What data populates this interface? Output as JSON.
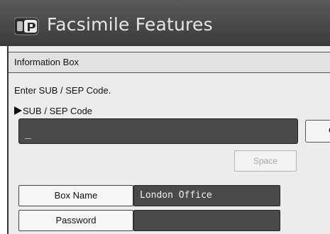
{
  "window": {
    "title": "Facsimile Features",
    "icon": "fax-machine-icon"
  },
  "section": {
    "title": "Information Box"
  },
  "instruction": "Enter SUB / SEP Code.",
  "code_field": {
    "label": "SUB / SEP Code",
    "value": "_"
  },
  "side_button": {
    "label": "C"
  },
  "space_button": {
    "label": "Space",
    "state": "disabled"
  },
  "fields": [
    {
      "label": "Box Name",
      "value": "London Office"
    },
    {
      "label": "Password",
      "value": ""
    }
  ],
  "colors": {
    "title_bar": "#3b3b3b",
    "input_bg": "#4a4a4a",
    "panel_bg": "#ececec"
  }
}
